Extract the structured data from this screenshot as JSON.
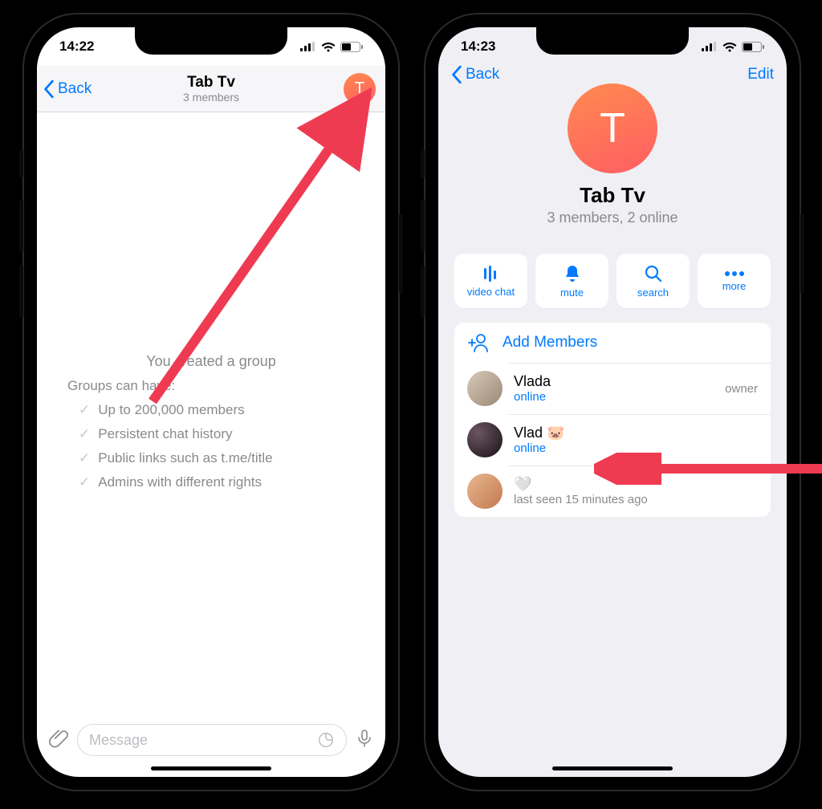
{
  "colors": {
    "accent": "#007aff",
    "avatar_gradient_from": "#ff8a50",
    "avatar_gradient_to": "#ff5e62"
  },
  "screen1": {
    "status_time": "14:22",
    "back_label": "Back",
    "title": "Tab Tv",
    "subtitle": "3 members",
    "avatar_letter": "T",
    "sys_created": "You created a group",
    "sys_intro": "Groups can have:",
    "bullets": [
      "Up to 200,000 members",
      "Persistent chat history",
      "Public links such as t.me/title",
      "Admins with different rights"
    ],
    "message_placeholder": "Message"
  },
  "screen2": {
    "status_time": "14:23",
    "back_label": "Back",
    "edit_label": "Edit",
    "avatar_letter": "T",
    "title": "Tab Tv",
    "subtitle": "3 members, 2 online",
    "actions": [
      {
        "id": "video-chat",
        "label": "video chat"
      },
      {
        "id": "mute",
        "label": "mute"
      },
      {
        "id": "search",
        "label": "search"
      },
      {
        "id": "more",
        "label": "more"
      }
    ],
    "add_members_label": "Add Members",
    "members": [
      {
        "name": "Vlada",
        "status": "online",
        "status_color": "blue",
        "role": "owner",
        "avatar": "photo1"
      },
      {
        "name": "Vlad 🐷",
        "status": "online",
        "status_color": "blue",
        "role": "",
        "avatar": "photo2"
      },
      {
        "name": "🤍",
        "status": "last seen 15 minutes ago",
        "status_color": "grey",
        "role": "",
        "avatar": "photo3"
      }
    ]
  }
}
